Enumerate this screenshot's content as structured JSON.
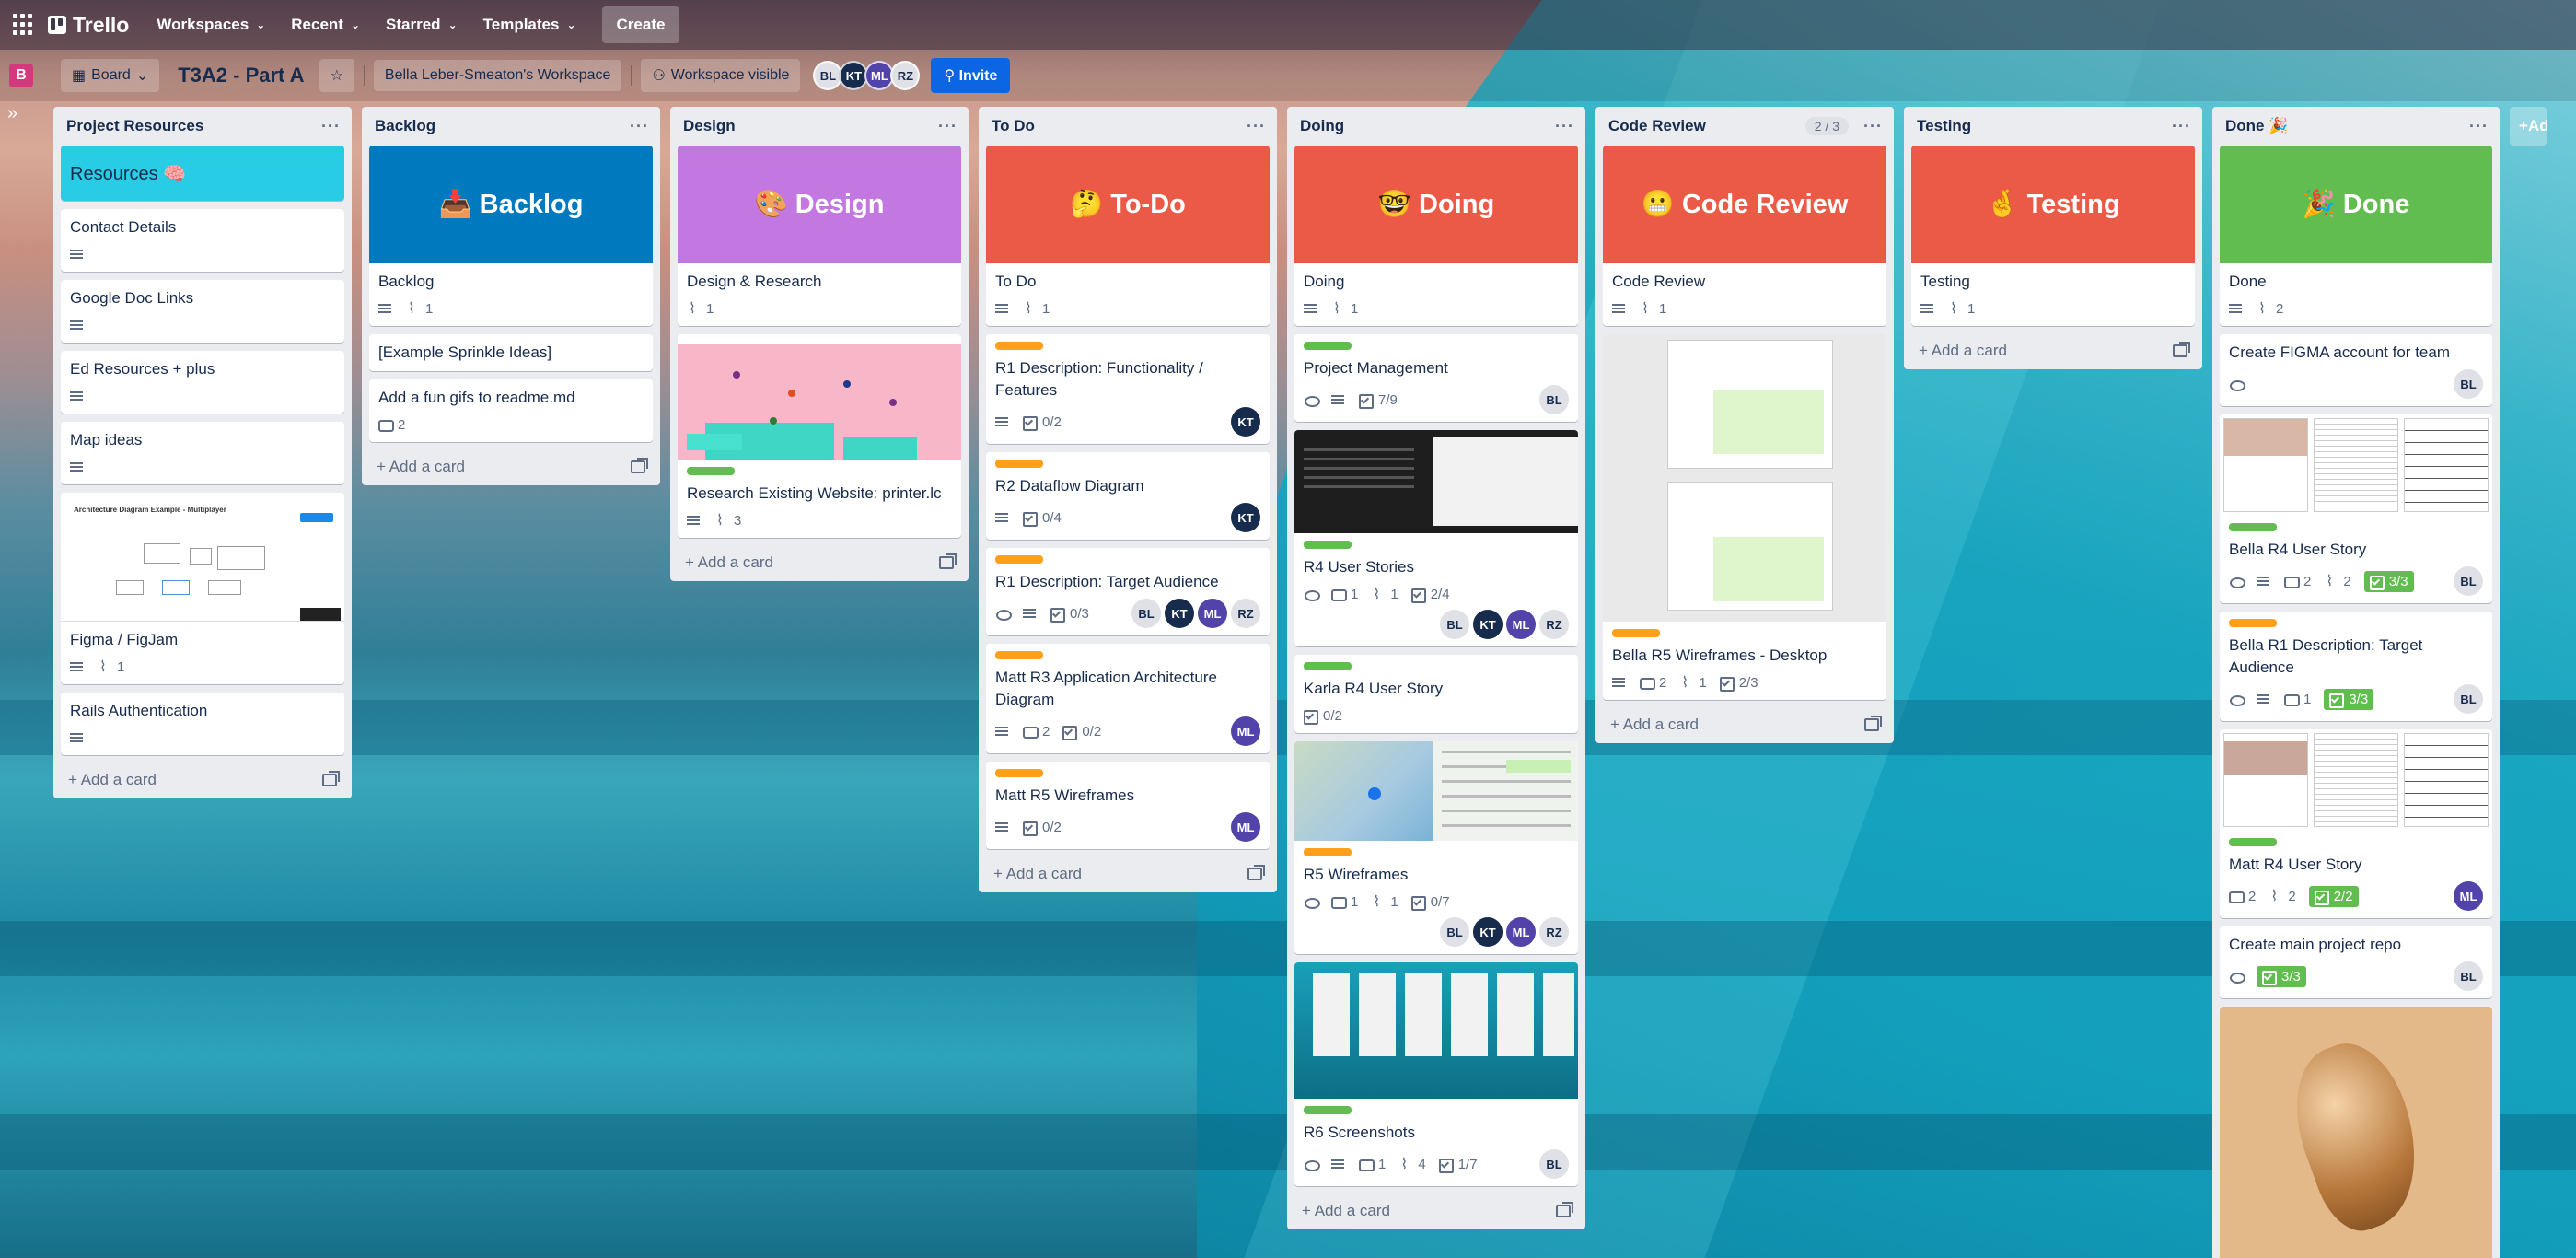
{
  "topbar": {
    "logo": "Trello",
    "nav": [
      "Workspaces",
      "Recent",
      "Starred",
      "Templates"
    ],
    "create": "Create"
  },
  "boardbar": {
    "workspace_letter": "B",
    "view": "Board",
    "title": "T3A2 - Part A",
    "workspace": "Bella Leber-Smeaton's Workspace",
    "visibility": "Workspace visible",
    "members": [
      "BL",
      "KT",
      "ML",
      "RZ"
    ],
    "invite": "Invite"
  },
  "add_card": "Add a card",
  "add_list": "Add another list",
  "lists": [
    {
      "name": "Project Resources",
      "cards": [
        {
          "title": "Resources 🧠"
        },
        {
          "title": "Contact Details"
        },
        {
          "title": "Google Doc Links"
        },
        {
          "title": "Ed Resources + plus"
        },
        {
          "title": "Map ideas"
        },
        {
          "title": "Figma / FigJam",
          "attach": "1",
          "thumb_title": "Architecture Diagram Example - Multiplayer"
        },
        {
          "title": "Rails Authentication"
        }
      ]
    },
    {
      "name": "Backlog",
      "cover": "📥 Backlog",
      "cards": [
        {
          "title": "Backlog",
          "attach": "1"
        },
        {
          "title": "[Example Sprinkle Ideas]"
        },
        {
          "title": "Add a fun gifs to readme.md",
          "comments": "2"
        }
      ]
    },
    {
      "name": "Design",
      "cover": "🎨 Design",
      "cards": [
        {
          "title": "Design & Research",
          "attach": "1"
        },
        {
          "title": "Research Existing Website: printer.lc",
          "attach": "3"
        }
      ]
    },
    {
      "name": "To Do",
      "cover": "🤔 To-Do",
      "cards": [
        {
          "title": "To Do",
          "attach": "1"
        },
        {
          "title": "R1 Description: Functionality / Features",
          "check": "0/2"
        },
        {
          "title": "R2 Dataflow Diagram",
          "check": "0/4"
        },
        {
          "title": "R1 Description: Target Audience",
          "check": "0/3"
        },
        {
          "title": "Matt R3 Application Architecture Diagram",
          "comments": "2",
          "check": "0/2"
        },
        {
          "title": "Matt R5 Wireframes",
          "check": "0/2"
        }
      ]
    },
    {
      "name": "Doing",
      "cover": "🤓 Doing",
      "cards": [
        {
          "title": "Doing",
          "attach": "1"
        },
        {
          "title": "Project Management",
          "check": "7/9"
        },
        {
          "title": "R4 User Stories",
          "comments": "1",
          "attach": "1",
          "check": "2/4"
        },
        {
          "title": "Karla R4 User Story",
          "check": "0/2"
        },
        {
          "title": "R5 Wireframes",
          "comments": "1",
          "attach": "1",
          "check": "0/7"
        },
        {
          "title": "R6 Screenshots",
          "comments": "1",
          "attach": "4",
          "check": "1/7"
        }
      ]
    },
    {
      "name": "Code Review",
      "count": "2 / 3",
      "cover": "😬 Code Review",
      "cards": [
        {
          "title": "Code Review",
          "attach": "1"
        },
        {
          "title": "Bella R5 Wireframes - Desktop",
          "comments": "2",
          "attach": "1",
          "check": "2/3"
        }
      ]
    },
    {
      "name": "Testing",
      "cover": "🤞 Testing",
      "cards": [
        {
          "title": "Testing",
          "attach": "1"
        }
      ]
    },
    {
      "name": "Done 🎉",
      "cover": "🎉 Done",
      "cards": [
        {
          "title": "Done",
          "attach": "2"
        },
        {
          "title": "Create FIGMA account for team"
        },
        {
          "title": "Bella R4 User Story",
          "comments": "2",
          "attach": "2",
          "check": "3/3"
        },
        {
          "title": "Bella R1 Description: Target Audience",
          "comments": "1",
          "check": "3/3"
        },
        {
          "title": "Matt R4 User Story",
          "comments": "2",
          "attach": "2",
          "check": "2/2"
        },
        {
          "title": "Create main project repo",
          "check": "3/3"
        }
      ]
    }
  ],
  "colors": {
    "cyan": "#29cce5",
    "blue": "#0079bf",
    "purple": "#c377e0",
    "red": "#eb5a46",
    "green": "#61bd4f",
    "orange": "#ff9f1a",
    "pink": "#f5b5c6"
  }
}
